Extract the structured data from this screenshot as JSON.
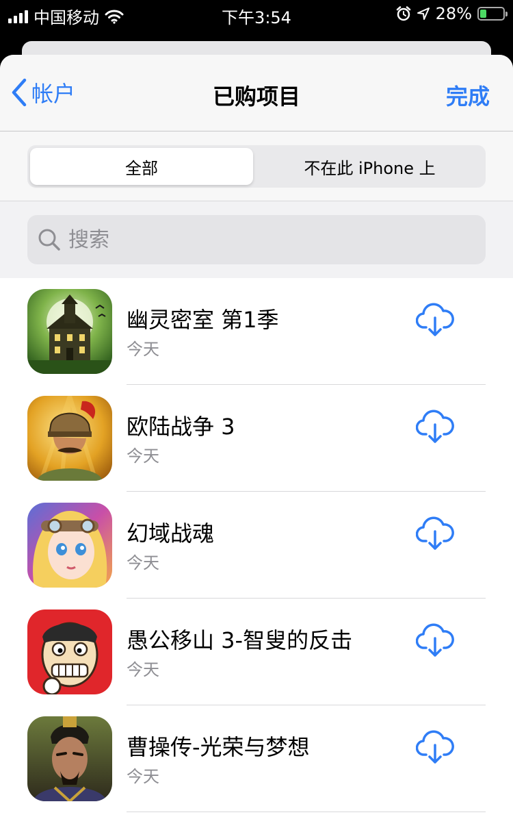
{
  "status": {
    "carrier": "中国移动",
    "time": "下午3:54",
    "battery": "28%",
    "battery_level": 0.28
  },
  "nav": {
    "back_label": "帐户",
    "title": "已购项目",
    "done_label": "完成"
  },
  "segments": {
    "all": "全部",
    "not_on_device": "不在此 iPhone 上"
  },
  "search": {
    "placeholder": "搜索"
  },
  "apps": [
    {
      "name": "幽灵密室 第1季",
      "date": "今天",
      "icon": "haunted-house-app-icon"
    },
    {
      "name": "欧陆战争 3",
      "date": "今天",
      "icon": "soldier-helmet-app-icon"
    },
    {
      "name": "幻域战魂",
      "date": "今天",
      "icon": "fantasy-girl-app-icon"
    },
    {
      "name": "愚公移山 3-智叟的反击",
      "date": "今天",
      "icon": "cartoon-face-app-icon"
    },
    {
      "name": "曹操传-光荣与梦想",
      "date": "今天",
      "icon": "warlord-portrait-app-icon"
    }
  ],
  "colors": {
    "accent": "#2f7df6",
    "secondary_text": "#8e8e93",
    "battery_green": "#4cd964"
  }
}
